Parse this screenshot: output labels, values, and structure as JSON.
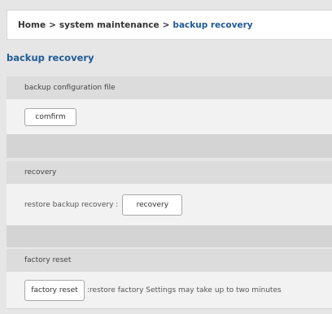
{
  "breadcrumb": {
    "home": "Home",
    "separator": ">",
    "system_maintenance": "system maintenance",
    "current": "backup recovery"
  },
  "page_title": "backup recovery",
  "backup_panel": {
    "header": "backup configuration file",
    "confirm_label": "comfirm"
  },
  "recovery_panel": {
    "header": "recovery",
    "label": "restore backup recovery :",
    "button_label": "recovery"
  },
  "factory_panel": {
    "header": "factory reset",
    "button_label": "factory reset",
    "hint": ":restore factory Settings may take up to two minutes"
  }
}
